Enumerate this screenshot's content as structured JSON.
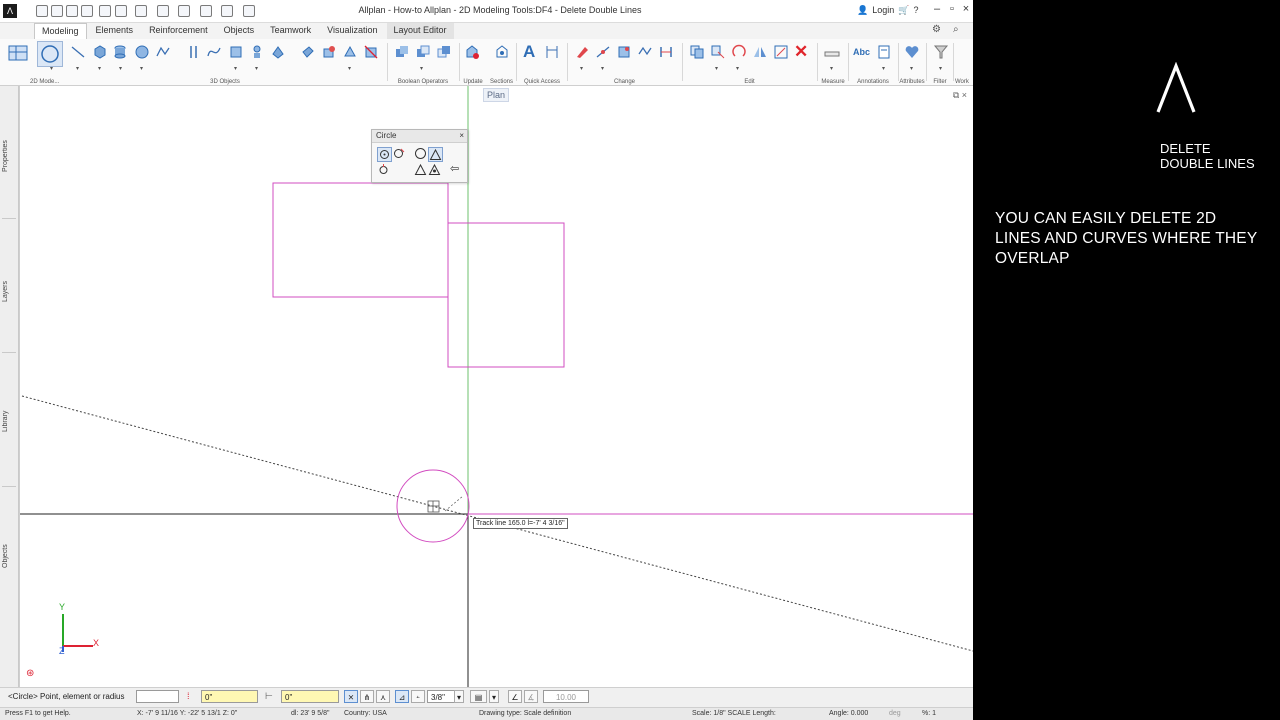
{
  "window": {
    "title": "Allplan - How-to Allplan - 2D Modeling Tools:DF4 - Delete Double Lines",
    "login_label": "Login",
    "logo_letter": "Λ"
  },
  "ribbon": {
    "tabs": [
      "Modeling",
      "Elements",
      "Reinforcement",
      "Objects",
      "Teamwork",
      "Visualization",
      "Layout Editor"
    ],
    "active_tab": "Modeling",
    "groups": [
      "2D Mode...",
      "3D Objects",
      "Boolean Operators",
      "Update",
      "Sections",
      "Quick Access",
      "Change",
      "Edit",
      "Measure",
      "Annotations",
      "Attributes",
      "Filter",
      "Work"
    ]
  },
  "side_tabs": [
    "Properties",
    "Layers",
    "Library",
    "Objects"
  ],
  "viewport": {
    "plan_label": "Plan",
    "tooltip": "Track line 165.0  l=-7' 4 3/16\""
  },
  "circle_palette": {
    "title": "Circle",
    "close": "×"
  },
  "axes": {
    "y": "Y",
    "x": "X",
    "z": "Z"
  },
  "dialog_line": {
    "prompt": "<Circle> Point, element or radius",
    "offset_x": "0\"",
    "offset_y": "0\"",
    "snap_value": "3/8\"",
    "angle_value": "10.00"
  },
  "status_bar": {
    "help": "Press F1 to get Help.",
    "coords": "X:  -7' 9 11/16 Y:  -22' 5 13/1 Z:  0\"",
    "dl": "dl:  23' 9 5/8\"",
    "country": "Country:  USA",
    "drawing_type": "Drawing type:   Scale definition",
    "scale": "Scale:   1/8\"   SCALE   Length:",
    "angle": "Angle:  0.000",
    "deg": "deg",
    "percent": "%:   1"
  },
  "video_overlay": {
    "subtitle_line1": "DELETE",
    "subtitle_line2": "DOUBLE LINES",
    "caption": "YOU CAN EASILY DELETE 2D LINES AND CURVES WHERE THEY OVERLAP"
  },
  "colors": {
    "overlay_bg": "#000000",
    "overlay_text": "#ffffff",
    "element_magenta": "#d24cc0",
    "track_green": "#6cc26c"
  }
}
